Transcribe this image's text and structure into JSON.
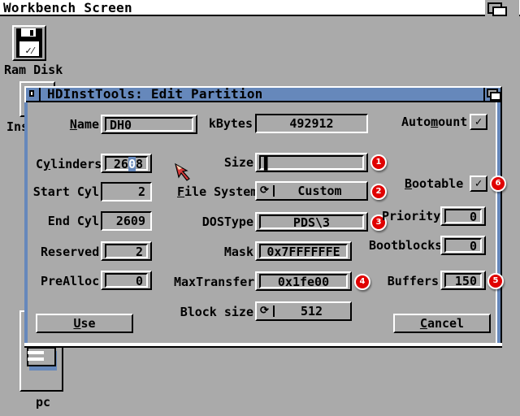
{
  "screen": {
    "title": "Workbench Screen"
  },
  "desktop_icons": [
    {
      "label": "Ram Disk",
      "icon": "floppy-disk-icon"
    },
    {
      "label": "Ins",
      "icon": "drawer-icon"
    },
    {
      "label": "pc",
      "icon": "drive-icon"
    }
  ],
  "window": {
    "title": "HDInstTools: Edit Partition"
  },
  "form": {
    "name": {
      "label_u": "N",
      "label_rest": "ame",
      "value": "DH0"
    },
    "kbytes": {
      "label": "kBytes",
      "value": "492912"
    },
    "automount": {
      "label_pre": "Auto",
      "label_u": "m",
      "label_rest": "ount",
      "checked": true,
      "check_glyph": "✓"
    },
    "cylinders": {
      "label_pre": "C",
      "label_u": "y",
      "label_rest": "linders",
      "value_pre": "26",
      "value_cursor": "0",
      "value_post": "8"
    },
    "size": {
      "label": "Size",
      "value": "▌"
    },
    "start_cyl": {
      "label": "Start Cyl",
      "value": "2"
    },
    "file_system": {
      "label_u": "F",
      "label_rest": "ile System",
      "value": "Custom"
    },
    "bootable": {
      "label_u": "B",
      "label_rest": "ootable",
      "checked": true,
      "check_glyph": "✓"
    },
    "end_cyl": {
      "label": "End Cyl",
      "value": "2609"
    },
    "dostype": {
      "label": "DOSType",
      "value": "PDS\\3"
    },
    "priority": {
      "label": "Priority",
      "value": "0"
    },
    "reserved": {
      "label": "Reserved",
      "value": "2"
    },
    "mask": {
      "label": "Mask",
      "value": "0x7FFFFFFE"
    },
    "bootblocks": {
      "label": "Bootblocks",
      "value": "0"
    },
    "prealloc": {
      "label": "PreAlloc",
      "value": "0"
    },
    "maxtransfer": {
      "label": "MaxTransfer",
      "value": "0x1fe00"
    },
    "buffers": {
      "label": "Buffers",
      "value": "150"
    },
    "block_size": {
      "label": "Block size",
      "value": "512"
    },
    "cycle_glyph": "⟳"
  },
  "buttons": {
    "use": {
      "label_u": "U",
      "label_rest": "se"
    },
    "cancel": {
      "label_u": "C",
      "label_rest": "ancel"
    }
  },
  "annotations": [
    "1",
    "2",
    "3",
    "4",
    "5",
    "6"
  ],
  "colors": {
    "background": "#aaaaaa",
    "titlebar": "#6688bb",
    "badge": "#e00000",
    "highlight": "#ffffff",
    "shadow": "#000000"
  }
}
